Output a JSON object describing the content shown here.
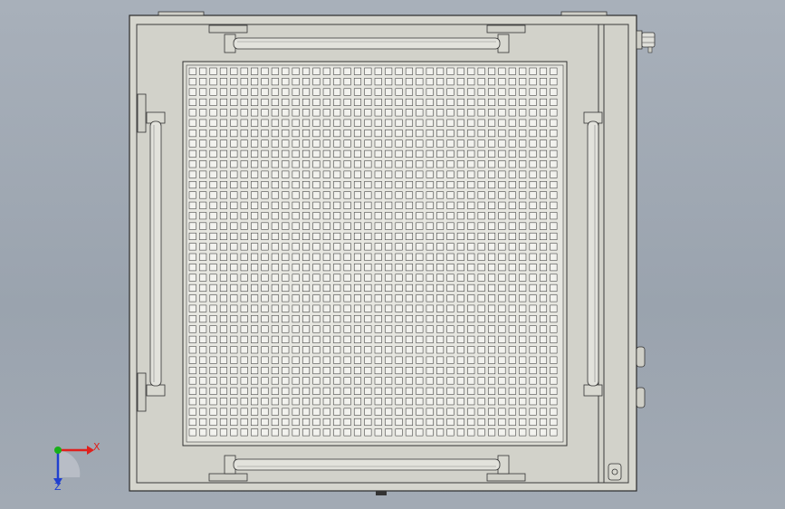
{
  "triad": {
    "x_label": "X",
    "z_label": "Z",
    "x_color": "#e0201c",
    "z_color": "#2040d0",
    "y_color": "#18b018"
  },
  "model": {
    "body_fill": "#d4d4cc",
    "outline": "#2a2a2a",
    "grid_rows": 36,
    "grid_cols": 36
  }
}
